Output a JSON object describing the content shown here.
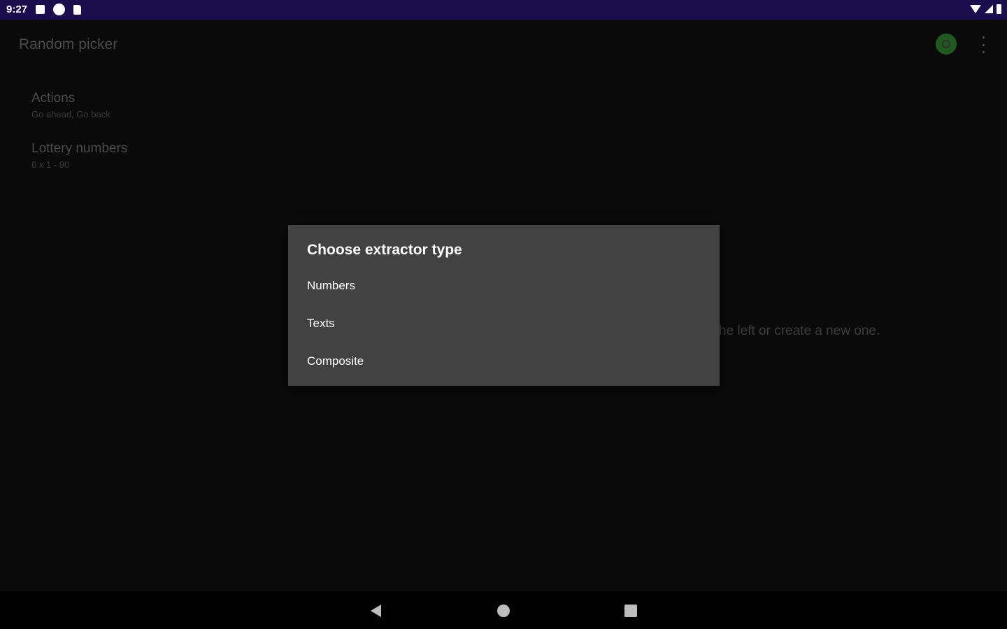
{
  "status_bar": {
    "time": "9:27",
    "icons_left": [
      "notification-icon",
      "app-badge-icon",
      "sd-card-icon"
    ],
    "icons_right": [
      "wifi-icon",
      "signal-icon",
      "battery-icon"
    ]
  },
  "app_bar": {
    "title": "Random picker",
    "avatar_icon": "avatar-icon",
    "menu_icon": "more-vert-icon"
  },
  "list": {
    "items": [
      {
        "title": "Actions",
        "subtitle": "Go ahead, Go back"
      },
      {
        "title": "Lottery numbers",
        "subtitle": "6 x 1 - 90"
      }
    ]
  },
  "main": {
    "hint": "he left or create a new one."
  },
  "dialog": {
    "title": "Choose extractor type",
    "options": [
      "Numbers",
      "Texts",
      "Composite"
    ]
  },
  "nav_bar": {
    "back_icon": "back-icon",
    "home_icon": "home-icon",
    "recents_icon": "recents-icon"
  },
  "colors": {
    "status_bar": "#1a0d4d",
    "background": "#0a0a0a",
    "dialog": "#424242",
    "avatar": "#1e5a1e"
  }
}
